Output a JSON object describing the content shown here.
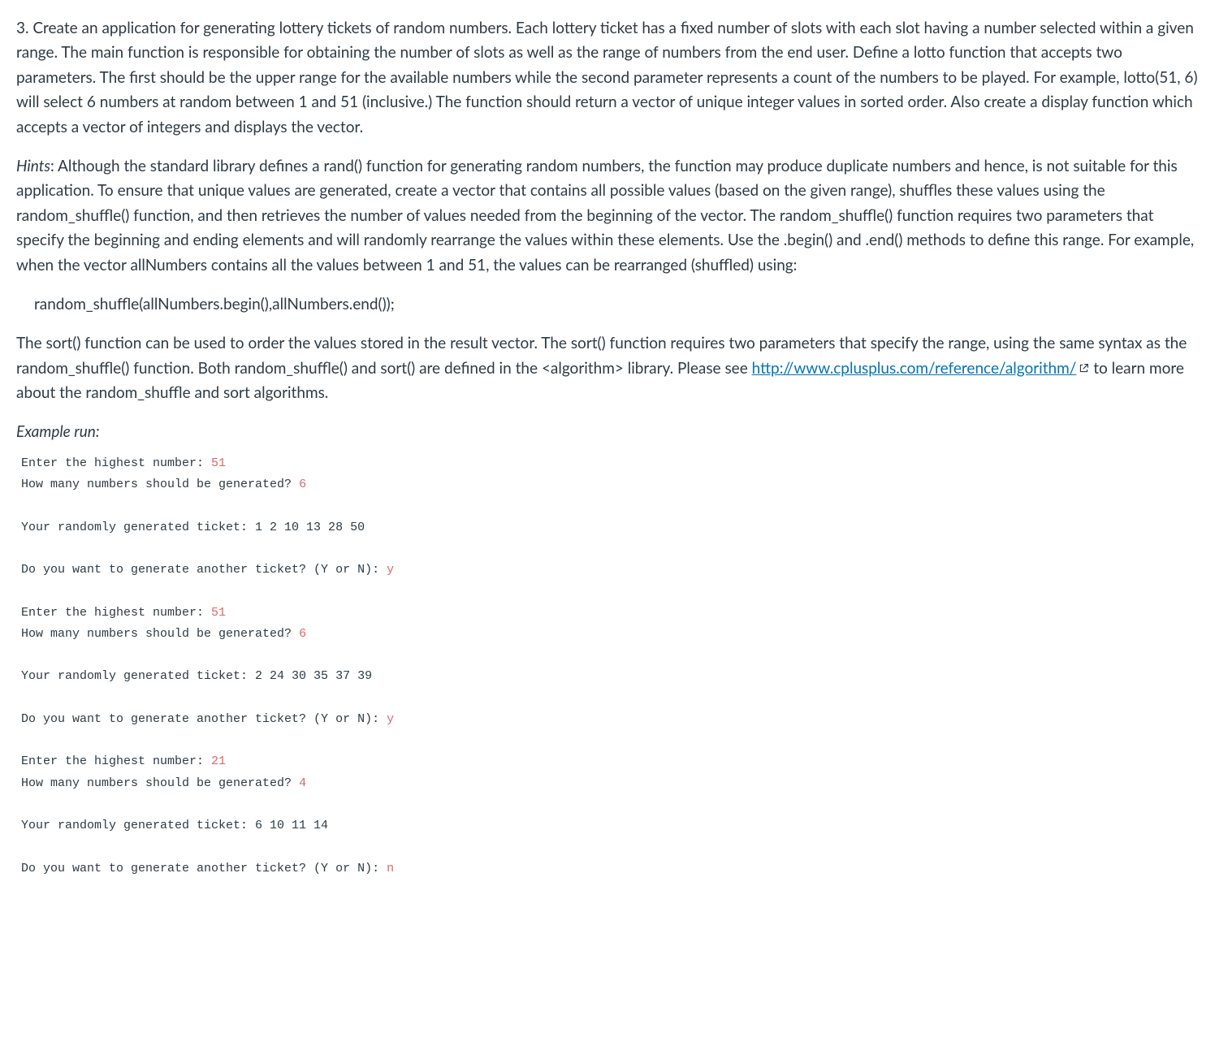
{
  "question": {
    "number": "3.",
    "p1": "3. Create an application for generating lottery tickets of random numbers. Each lottery ticket has a fixed number of slots with each slot having a number selected within a given range. The main function is responsible for obtaining the number of slots as well as the range of numbers from the end user.  Define a lotto function that accepts two parameters. The first should be the upper range for the available numbers while the second parameter represents a count of the numbers to be played. For example, lotto(51, 6) will select 6 numbers at random between 1 and 51 (inclusive.) The function should return a vector of unique integer values in sorted order.  Also create a display function which accepts a vector of integers and displays the vector.",
    "hints_label": "Hints",
    "hints_text": ": Although the standard library defines a rand() function for generating random numbers, the function may produce duplicate numbers and hence, is not suitable for this application. To ensure that unique values are generated, create a vector that contains all possible values (based on the given range), shuffles these values using the random_shuffle() function, and then retrieves the number of values needed from the beginning of the vector. The random_shuffle() function requires two parameters that specify the beginning and ending elements and will randomly rearrange the values within these elements. Use the .begin() and .end() methods to define this range.  For example, when the vector allNumbers contains all the values between 1 and 51, the values can be rearranged (shuffled) using:",
    "code_line": "random_shuffle(allNumbers.begin(),allNumbers.end());",
    "p3_before_link": "The sort() function can be used to order the values stored in the result vector. The sort() function requires two parameters that specify the range, using the same syntax as the random_shuffle() function. Both random_shuffle() and sort() are defined in the <algorithm> library.  Please see ",
    "link_text": "http://www.cplusplus.com/reference/algorithm/",
    "p3_after_link": "  to learn more about the random_shuffle and sort algorithms.",
    "example_label": "Example run:",
    "runs": [
      {
        "prompt_high": "Enter the highest number: ",
        "high": "51",
        "prompt_count": "How many numbers should be generated? ",
        "count": "6",
        "ticket_label": "Your randomly generated ticket: ",
        "ticket": "1 2 10 13 28 50",
        "again_prompt": "Do you want to generate another ticket? (Y or N): ",
        "again": "y"
      },
      {
        "prompt_high": "Enter the highest number: ",
        "high": "51",
        "prompt_count": "How many numbers should be generated? ",
        "count": "6",
        "ticket_label": "Your randomly generated ticket: ",
        "ticket": "2 24 30 35 37 39",
        "again_prompt": "Do you want to generate another ticket? (Y or N): ",
        "again": "y"
      },
      {
        "prompt_high": "Enter the highest number: ",
        "high": "21",
        "prompt_count": "How many numbers should be generated? ",
        "count": "4",
        "ticket_label": "Your randomly generated ticket: ",
        "ticket": "6 10 11 14",
        "again_prompt": "Do you want to generate another ticket? (Y or N): ",
        "again": "n"
      }
    ]
  }
}
